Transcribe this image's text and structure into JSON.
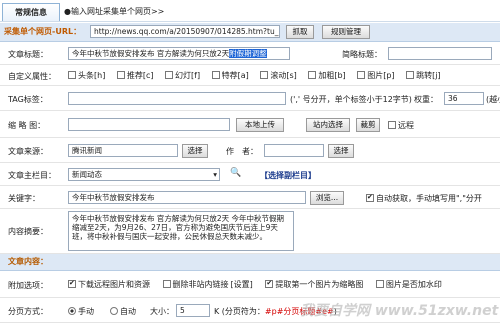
{
  "tabs": {
    "active": "常规信息",
    "second": "●输入网址采集单个网页>>"
  },
  "url_bar": {
    "label": "采集单个网页-URL：",
    "value": "http://news.qq.com/a/20150907/014285.htm?tu_biz=",
    "fetch_label": "抓取",
    "rules_label": "规则管理"
  },
  "title_row": {
    "label": "文章标题：",
    "value_plain": "今年中秋节放假安排发布 官方解读为何只放2天",
    "value_selected": "附假期调整",
    "short_label": "简略标题："
  },
  "attr_row": {
    "label": "自定义属性：",
    "items": [
      "头条[h]",
      "推荐[c]",
      "幻灯[f]",
      "特荐[a]",
      "滚动[s]",
      "加粗[b]",
      "图片[p]",
      "跳转[j]"
    ]
  },
  "tag_row": {
    "label": "TAG标签：",
    "hint": "(',' 号分开，单个标签小于12字节)",
    "weight_label": "权重：",
    "weight_value": "36",
    "weight_hint": "(越小"
  },
  "thumb_row": {
    "label": "缩 略 图：",
    "upload_label": "本地上传",
    "site_select_label": "站内选择",
    "crop_label": "裁剪",
    "remote_label": "远程"
  },
  "source_row": {
    "label": "文章来源：",
    "value": "腾讯新闻",
    "select_label": "选择",
    "author_label": "作　者：",
    "author_select_label": "选择"
  },
  "column_row": {
    "label": "文章主栏目：",
    "value": "新闻动态",
    "sub_label": "【选择副栏目】"
  },
  "keyword_row": {
    "label": "关键字：",
    "value": "今年中秋节放假安排发布",
    "browse_label": "浏览...",
    "auto_label": "自动获取，手动填写用\",\"分开"
  },
  "summary_row": {
    "label": "内容摘要：",
    "value": "今年中秋节放假安排发布 官方解读为何只放2天 今年中秋节假期缩减至2天，为9月26、27日，官方称为避免国庆节后连上9天班，将中秋补假与国庆一起安排，公民休假总天数未减少。"
  },
  "content_section": {
    "label": "文章内容："
  },
  "options_row": {
    "label": "附加选项：",
    "opt1": "下载远程图片和资源",
    "opt2": "删除非站内链接",
    "opt2_link": "[设置]",
    "opt3": "提取第一个图片为缩略图",
    "opt4": "图片是否加水印"
  },
  "paging_row": {
    "label": "分页方式：",
    "manual": "手动",
    "auto": "自动",
    "size_label": "大小：",
    "size_value": "5",
    "unit": "K (分页符为：",
    "marker": "#p#分页标题#e#",
    "tail": ")"
  },
  "watermark": "我要自学网 www.51zxw.net"
}
